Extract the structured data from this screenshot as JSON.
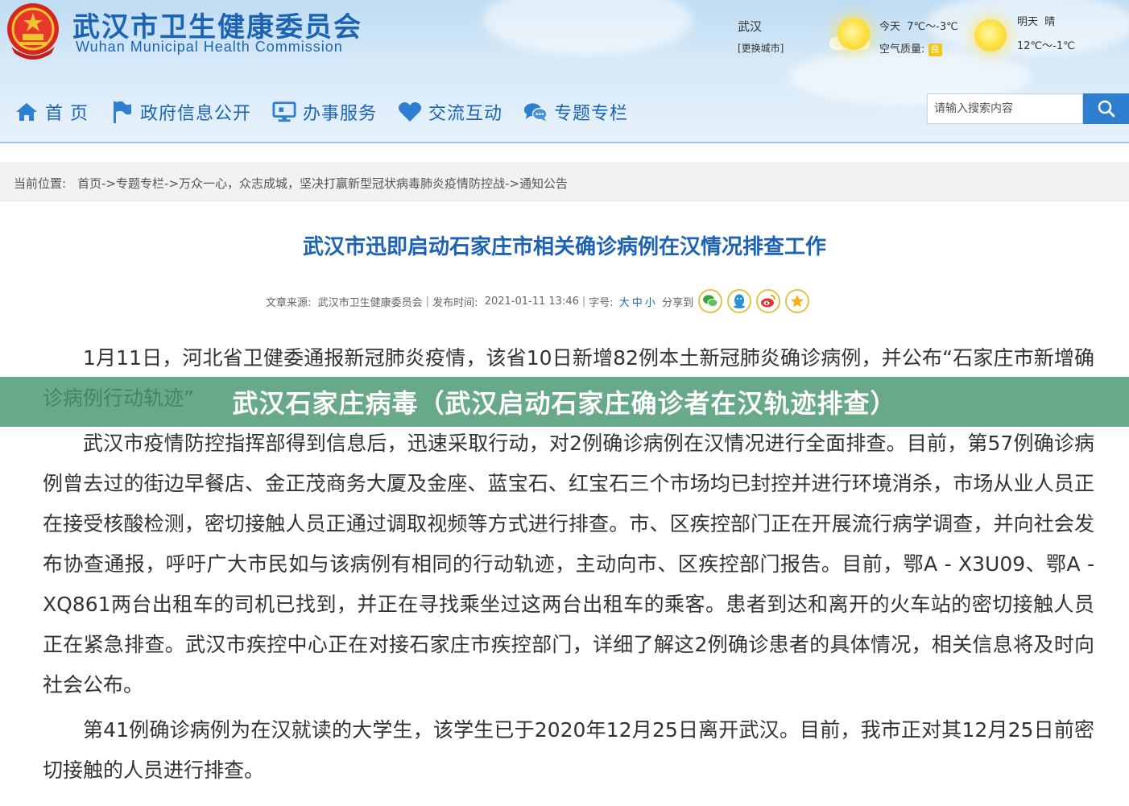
{
  "header": {
    "title_cn": "武汉市卫生健康委员会",
    "title_en": "Wuhan Municipal Health Commission",
    "city": "武汉",
    "change_city": "[更换城市]",
    "today_label": "今天",
    "today_temp": "7℃～-3℃",
    "air_quality_label": "空气质量:",
    "air_quality_value": "良",
    "tomorrow_label": "明天",
    "tomorrow_weather": "晴",
    "tomorrow_temp": "12℃～-1℃"
  },
  "nav": [
    {
      "label": "首 页",
      "icon": "home-icon"
    },
    {
      "label": "政府信息公开",
      "icon": "flag-icon"
    },
    {
      "label": "办事服务",
      "icon": "computer-icon"
    },
    {
      "label": "交流互动",
      "icon": "heart-icon"
    },
    {
      "label": "专题专栏",
      "icon": "chat-icon"
    }
  ],
  "search": {
    "placeholder": "请输入搜索内容",
    "button_icon": "search-icon"
  },
  "breadcrumb": {
    "label": "当前位置:",
    "path": "首页->专题专栏->万众一心，众志成城，坚决打赢新型冠状病毒肺炎疫情防控战->通知公告"
  },
  "article": {
    "title": "武汉市迅即启动石家庄市相关确诊病例在汉情况排查工作",
    "source_label": "文章来源:",
    "source": "武汉市卫生健康委员会",
    "date_label": "发布时间:",
    "date": "2021-01-11 13:46",
    "font_label": "字号:",
    "font_large": "大",
    "font_medium": "中",
    "font_small": "小",
    "share_label": "分享到",
    "share_icons": [
      "wechat-icon",
      "qq-icon",
      "weibo-icon",
      "favorite-icon"
    ],
    "paragraphs": [
      "1月11日，河北省卫健委通报新冠肺炎疫情，该省10日新增82例本土新冠肺炎确诊病例，并公布“石家庄市新增确诊病例行动轨迹”",
      "武汉市疫情防控指挥部得到信息后，迅速采取行动，对2例确诊病例在汉情况进行全面排查。目前，第57例确诊病例曾去过的街边早餐店、金正茂商务大厦及金座、蓝宝石、红宝石三个市场均已封控并进行环境消杀，市场从业人员正在接受核酸检测，密切接触人员正通过调取视频等方式进行排查。市、区疾控部门正在开展流行病学调查，并向社会发布协查通报，呼吁广大市民如与该病例有相同的行动轨迹，主动向市、区疾控部门报告。目前，鄂A - X3U09、鄂A - XQ861两台出租车的司机已找到，并正在寻找乘坐过这两台出租车的乘客。患者到达和离开的火车站的密切接触人员正在紧急排查。武汉市疾控中心正在对接石家庄市疾控部门，详细了解这2例确诊患者的具体情况，相关信息将及时向社会公布。",
      "第41例确诊病例为在汉就读的大学生，该学生已于2020年12月25日离开武汉。目前，我市正对其12月25日前密切接触的人员进行排查。"
    ]
  },
  "overlay": {
    "text": "武汉石家庄病毒（武汉启动石家庄确诊者在汉轨迹排查）"
  },
  "colors": {
    "brand_blue": "#1d63b4",
    "search_button": "#2f7fd0",
    "overlay_green": "#46966e",
    "emblem_red": "#d7261e"
  }
}
